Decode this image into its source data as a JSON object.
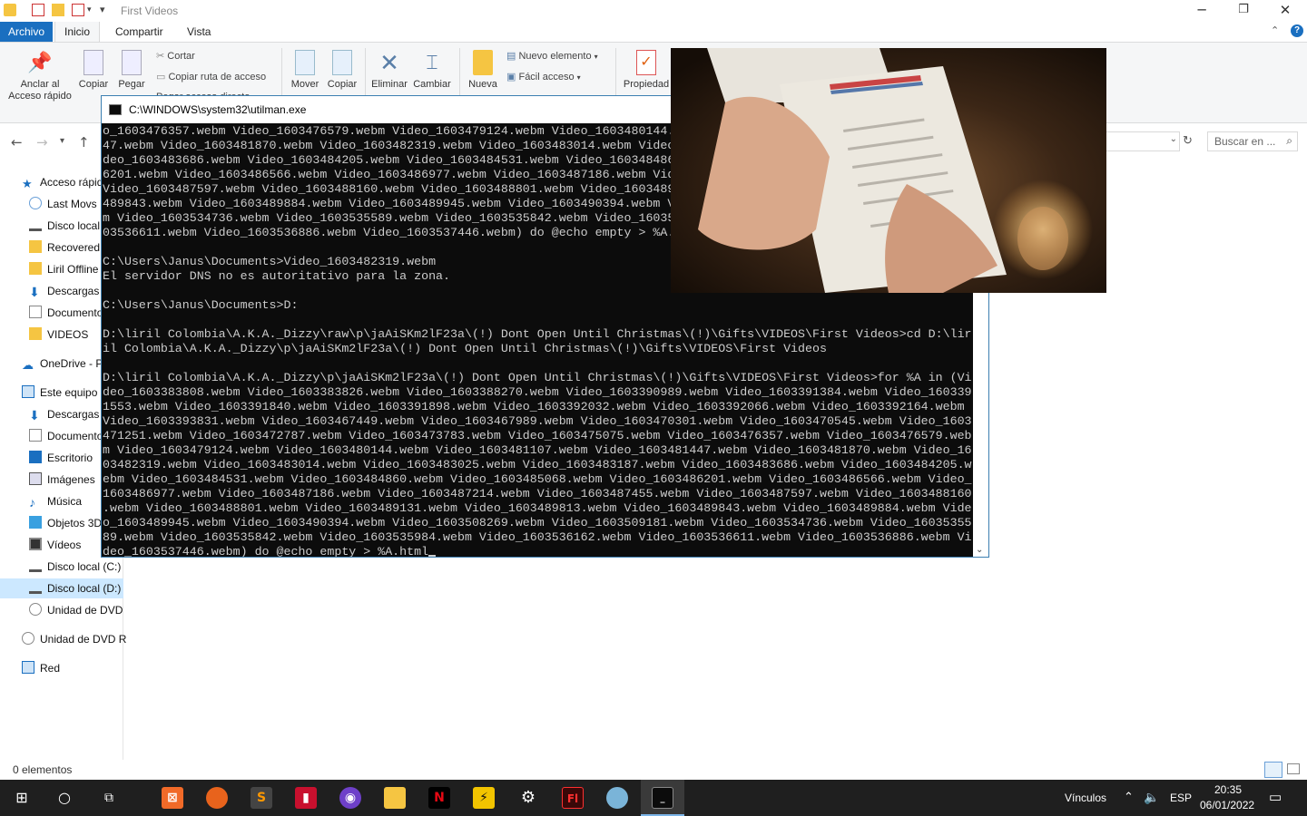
{
  "explorer": {
    "title": "First Videos",
    "tabs": {
      "file": "Archivo",
      "home": "Inicio",
      "share": "Compartir",
      "view": "Vista"
    },
    "ribbon": {
      "pin": "Anclar al\nAcceso rápido",
      "copy": "Copiar",
      "paste": "Pegar",
      "cut": "Cortar",
      "copy_path": "Copiar ruta de acceso",
      "paste_shortcut": "Pegar acceso directo",
      "move": "Mover",
      "copy_to": "Copiar",
      "delete": "Eliminar",
      "rename": "Cambiar",
      "new_folder": "Nueva",
      "new_item": "Nuevo elemento",
      "easy_access": "Fácil acceso",
      "properties": "Propiedad"
    },
    "search_placeholder": "Buscar en ...",
    "sidebar": [
      "Acceso rápido",
      "Last Movs",
      "Disco local",
      "Recovered",
      "Liril Offline",
      "Descargas",
      "Documentos",
      "VIDEOS",
      "OneDrive - P",
      "Este equipo",
      "Descargas",
      "Documentos",
      "Escritorio",
      "Imágenes",
      "Música",
      "Objetos 3D",
      "Vídeos",
      "Disco local (C:)",
      "Disco local (D:)",
      "Unidad de DVD",
      "Unidad de DVD R",
      "Red"
    ],
    "status": "0 elementos"
  },
  "cmd": {
    "title": "C:\\WINDOWS\\system32\\utilman.exe",
    "lines": [
      "o_1603476357.webm Video_1603476579.webm Video_1603479124.webm Video_1603480144.webm Video_1603481107.webm Video_16034814",
      "47.webm Video_1603481870.webm Video_1603482319.webm Video_1603483014.webm Video_1603483025.webm Video_1603483187.webm Vi",
      "deo_1603483686.webm Video_1603484205.webm Video_1603484531.webm Video_1603484860.webm Video_1603485068.webm Video_160348",
      "6201.webm Video_1603486566.webm Video_1603486977.webm Video_1603487186.webm Video_1603487214.webm Video_1603487455.webm ",
      "Video_1603487597.webm Video_1603488160.webm Video_1603488801.webm Video_1603489131.webm Video_1603489813.webm Video_1603",
      "489843.webm Video_1603489884.webm Video_1603489945.webm Video_1603490394.webm Video_1603508269.webm Video_1603509181.web",
      "m Video_1603534736.webm Video_1603535589.webm Video_1603535842.webm Video_1603535984.webm Video_1603536162.webm Video_16",
      "03536611.webm Video_1603536886.webm Video_1603537446.webm) do @echo empty > %A.html",
      "",
      "C:\\Users\\Janus\\Documents>Video_1603482319.webm",
      "El servidor DNS no es autoritativo para la zona.",
      "",
      "C:\\Users\\Janus\\Documents>D:",
      "",
      "D:\\liril Colombia\\A.K.A._Dizzy\\raw\\p\\jaAiSKm2lF23a\\(!) Dont Open Until Christmas\\(!)\\Gifts\\VIDEOS\\First Videos>cd D:\\lir",
      "il Colombia\\A.K.A._Dizzy\\p\\jaAiSKm2lF23a\\(!) Dont Open Until Christmas\\(!)\\Gifts\\VIDEOS\\First Videos",
      "",
      "D:\\liril Colombia\\A.K.A._Dizzy\\p\\jaAiSKm2lF23a\\(!) Dont Open Until Christmas\\(!)\\Gifts\\VIDEOS\\First Videos>for %A in (Vi",
      "deo_1603383808.webm Video_1603383826.webm Video_1603388270.webm Video_1603390989.webm Video_1603391384.webm Video_160339",
      "1553.webm Video_1603391840.webm Video_1603391898.webm Video_1603392032.webm Video_1603392066.webm Video_1603392164.webm ",
      "Video_1603393831.webm Video_1603467449.webm Video_1603467989.webm Video_1603470301.webm Video_1603470545.webm Video_1603",
      "471251.webm Video_1603472787.webm Video_1603473783.webm Video_1603475075.webm Video_1603476357.webm Video_1603476579.web",
      "m Video_1603479124.webm Video_1603480144.webm Video_1603481107.webm Video_1603481447.webm Video_1603481870.webm Video_16",
      "03482319.webm Video_1603483014.webm Video_1603483025.webm Video_1603483187.webm Video_1603483686.webm Video_1603484205.w",
      "ebm Video_1603484531.webm Video_1603484860.webm Video_1603485068.webm Video_1603486201.webm Video_1603486566.webm Video_",
      "1603486977.webm Video_1603487186.webm Video_1603487214.webm Video_1603487455.webm Video_1603487597.webm Video_1603488160",
      ".webm Video_1603488801.webm Video_1603489131.webm Video_1603489813.webm Video_1603489843.webm Video_1603489884.webm Vide",
      "o_1603489945.webm Video_1603490394.webm Video_1603508269.webm Video_1603509181.webm Video_1603534736.webm Video_16035355",
      "89.webm Video_1603535842.webm Video_1603535984.webm Video_1603536162.webm Video_1603536611.webm Video_1603536886.webm Vi",
      "deo_1603537446.webm) do @echo empty > %A.html"
    ]
  },
  "taskbar": {
    "links_label": "Vínculos",
    "language": "ESP",
    "time": "20:35",
    "date": "06/01/2022"
  }
}
